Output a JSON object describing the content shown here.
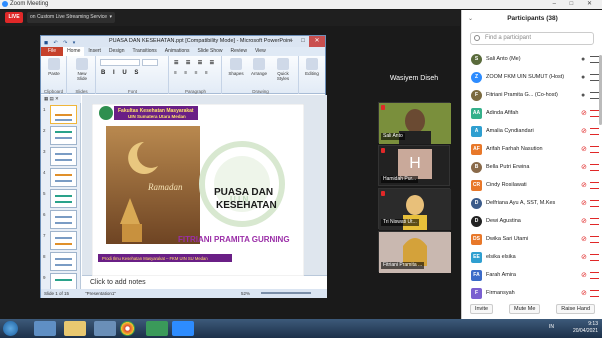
{
  "window": {
    "title": "Zoom Meeting",
    "controls": "– □ ✕"
  },
  "live": {
    "badge": "LIVE",
    "text": "on Custom Live Streaming Service"
  },
  "ppt": {
    "title": "PUASA DAN KESEHATAN.ppt [Compatibility Mode] - Microsoft PowerPoint",
    "tabs": [
      "File",
      "Home",
      "Insert",
      "Design",
      "Transitions",
      "Animations",
      "Slide Show",
      "Review",
      "View"
    ],
    "ribbon": {
      "paste": "Paste",
      "new_slide": "New Slide",
      "shapes": "Shapes",
      "arrange": "Arrange",
      "quick_styles": "Quick Styles",
      "editing": "Editing",
      "groups": [
        "Clipboard",
        "Slides",
        "Font",
        "Paragraph",
        "Drawing"
      ]
    },
    "thumbs": [
      "1",
      "2",
      "3",
      "4",
      "5",
      "6",
      "7",
      "8",
      "9"
    ],
    "notes_placeholder": "Click to add notes",
    "status_slide": "Slide 1 of 15",
    "status_theme": "\"Presentation1\"",
    "zoom_level": "52%"
  },
  "slide": {
    "faculty_line1": "Fakultas Kesehatan Masyarakat",
    "faculty_line2": "UIN Sumatera Utara Medan",
    "ramadan": "Ramadan",
    "title1": "PUASA DAN",
    "title2": "KESEHATAN",
    "presenter": "FITRIANI PRAMITA GURNING",
    "footer": "Prodi Ilmu Kesehatan Masyarakat – FKM UIN SU Medan",
    "uin": "U I N"
  },
  "videos": {
    "top_name": "Wasiyem Diseh",
    "tiles": [
      {
        "name": "Sali Anto"
      },
      {
        "name": "Hamidah Pur...",
        "initial": "H"
      },
      {
        "name": "Tri Niswati Ut..."
      },
      {
        "name": "Fitriani Pramita ..."
      }
    ]
  },
  "participants": {
    "header": "Participants (38)",
    "search_placeholder": "Find a participant",
    "list": [
      {
        "name": "Sali Anto (Me)",
        "initial": "S",
        "color": "#5a6b3c",
        "photo": true,
        "mic": "on"
      },
      {
        "name": "ZOOM FKM UIN SUMUT (Host)",
        "initial": "Z",
        "color": "#2d8cff",
        "photo": true,
        "mic": "on"
      },
      {
        "name": "Fitriani Pramita G...  (Co-host)",
        "initial": "F",
        "color": "#7b6a3f",
        "photo": true,
        "mic": "on"
      },
      {
        "name": "Adinda Afifah",
        "initial": "AA",
        "color": "#35b08b",
        "photo": false,
        "mic": "muted"
      },
      {
        "name": "Amalia Cyndiandari",
        "initial": "A",
        "color": "#2f9fd0",
        "photo": false,
        "mic": "muted"
      },
      {
        "name": "Arifah Farhah Nasution",
        "initial": "AF",
        "color": "#e8782a",
        "photo": false,
        "mic": "muted"
      },
      {
        "name": "Bella Putri Erwina",
        "initial": "B",
        "color": "#8a6a4a",
        "photo": true,
        "mic": "muted"
      },
      {
        "name": "Cindy Rosilawati",
        "initial": "CR",
        "color": "#e8782a",
        "photo": false,
        "mic": "muted"
      },
      {
        "name": "Delfriana Ayu A, SST, M.Kes",
        "initial": "D",
        "color": "#3b5b8a",
        "photo": true,
        "mic": "muted"
      },
      {
        "name": "Dewi Agustina",
        "initial": "D",
        "color": "#222222",
        "photo": true,
        "mic": "muted"
      },
      {
        "name": "Dwika Sari Utami",
        "initial": "DS",
        "color": "#e8782a",
        "photo": false,
        "mic": "muted"
      },
      {
        "name": "elsika elsika",
        "initial": "EE",
        "color": "#2f9fd0",
        "photo": false,
        "mic": "muted"
      },
      {
        "name": "Farah Amira",
        "initial": "FA",
        "color": "#3b6bc8",
        "photo": false,
        "mic": "muted"
      },
      {
        "name": "Firmansyah",
        "initial": "F",
        "color": "#7a5fd0",
        "photo": false,
        "mic": "muted"
      }
    ],
    "buttons": {
      "invite": "Invite",
      "mute_me": "Mute Me",
      "raise_hand": "Raise Hand"
    }
  },
  "taskbar": {
    "lang": "IN",
    "time": "9:13",
    "date": "20/04/2021"
  }
}
